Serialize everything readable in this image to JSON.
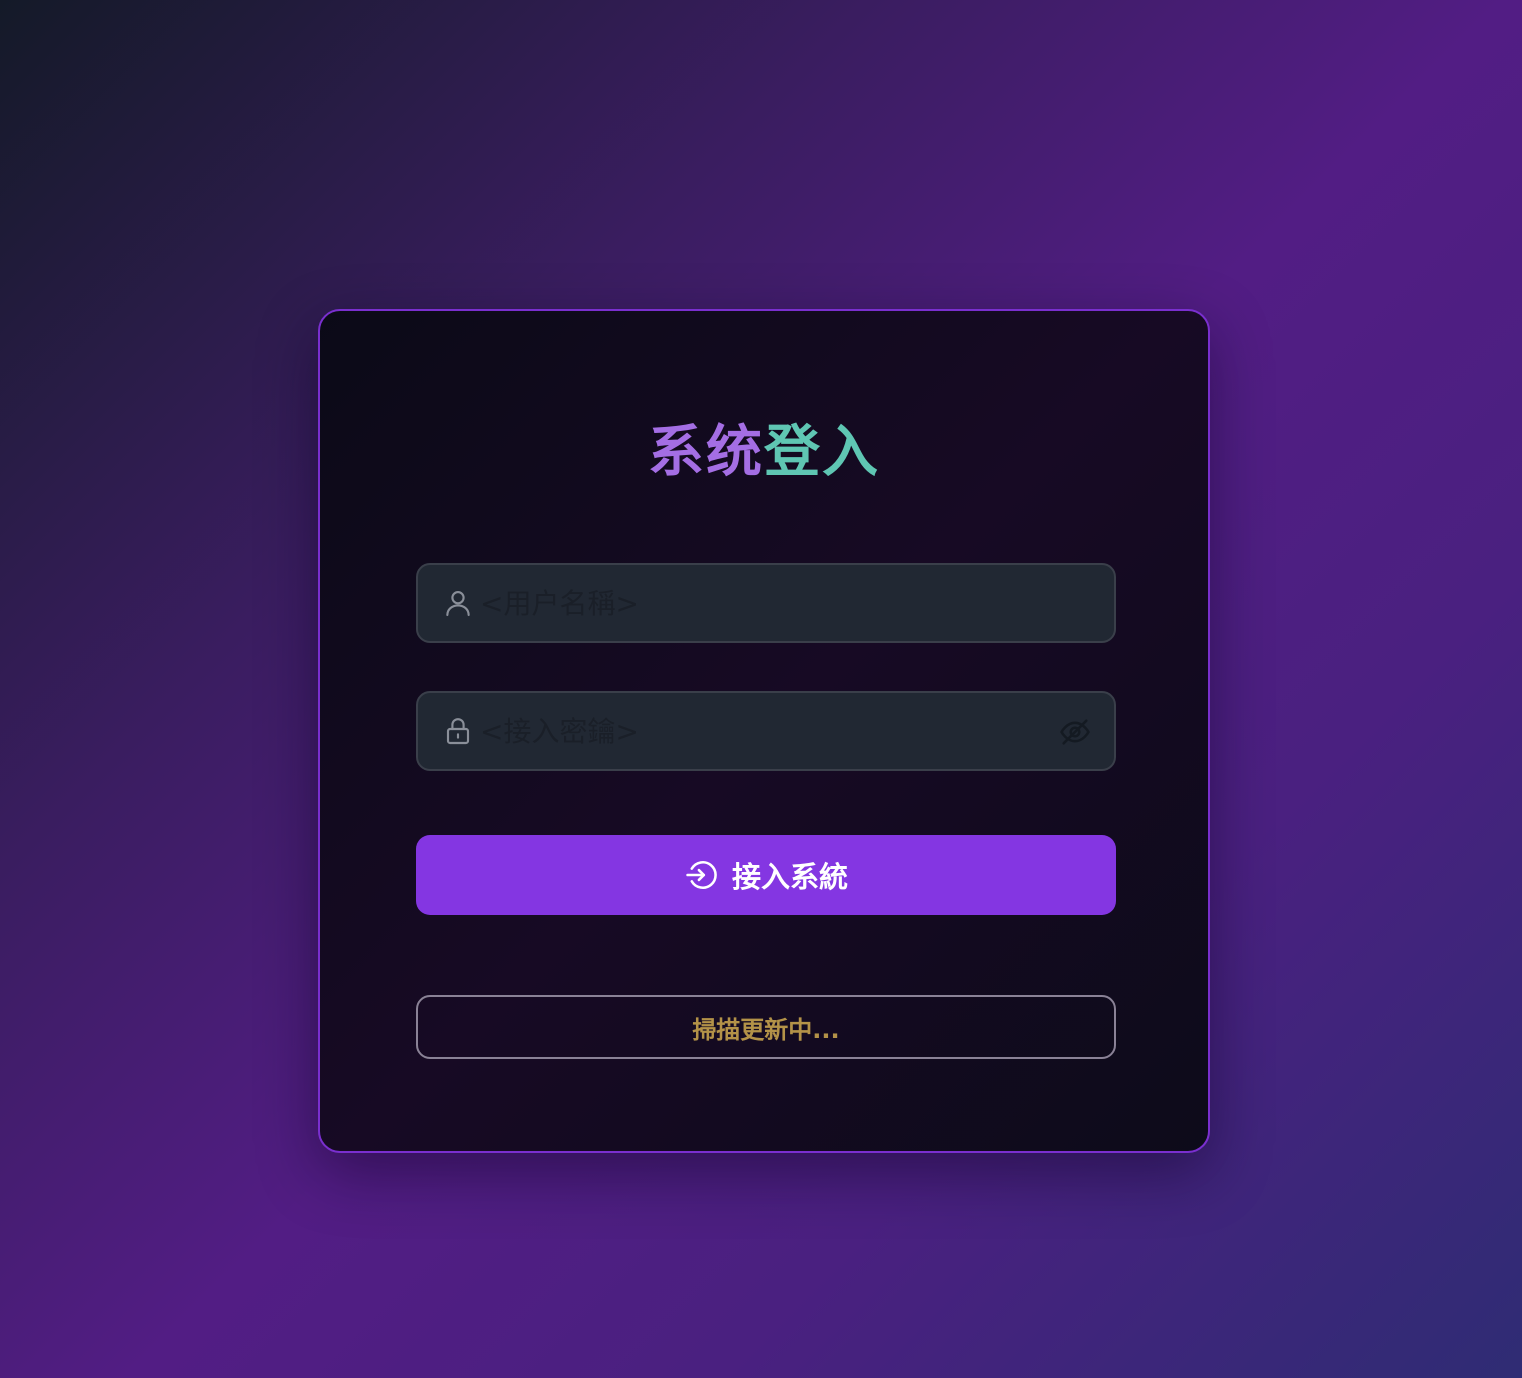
{
  "login": {
    "title_part1": "系统",
    "title_part2": "登入",
    "username": {
      "placeholder": "<用户名稱>",
      "value": "",
      "icon": "user-icon"
    },
    "password": {
      "placeholder": "<接入密鑰>",
      "value": "",
      "icon": "lock-icon",
      "toggle_icon": "eye-off-icon"
    },
    "submit": {
      "label": "接入系統",
      "icon": "login-arrow-icon"
    },
    "status_text": "掃描更新中..."
  },
  "colors": {
    "accent": "#8436e2",
    "title_purple": "#a46ee4",
    "title_teal": "#5fc6b3",
    "status_gold": "#b39248"
  }
}
